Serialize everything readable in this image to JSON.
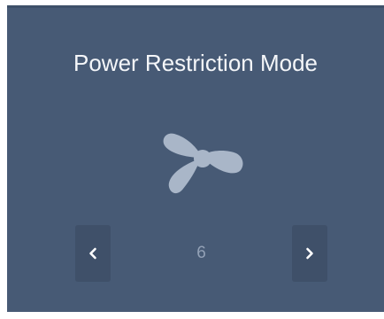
{
  "panel": {
    "title": "Power Restriction Mode",
    "icon": "fan-icon",
    "stepper": {
      "value": "6",
      "prev_icon": "chevron-left-icon",
      "next_icon": "chevron-right-icon"
    }
  },
  "colors": {
    "panel_bg": "#475a75",
    "button_bg": "#3f5069",
    "title_text": "#f4f6f9",
    "icon_fill": "#a9b6c8",
    "value_text": "#93a1b6"
  }
}
